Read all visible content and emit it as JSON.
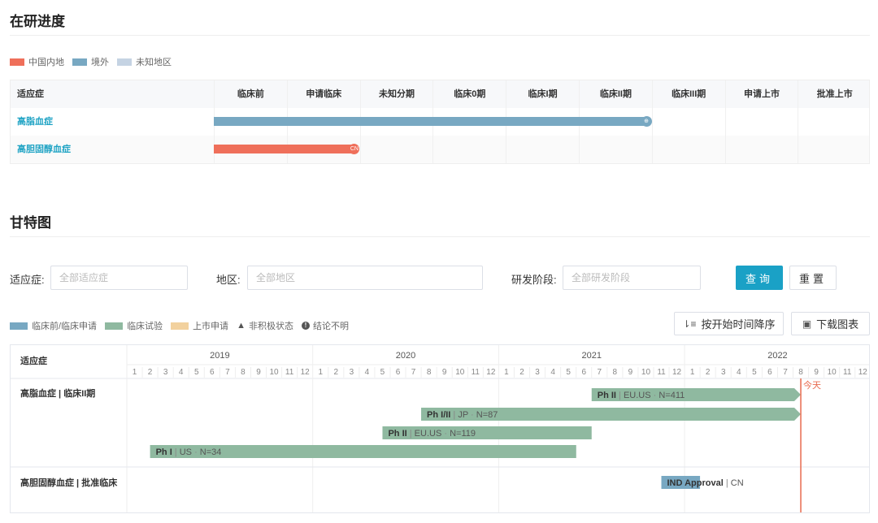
{
  "progress": {
    "title": "在研进度",
    "legend": [
      {
        "label": "中国内地",
        "color": "#ef6f5a"
      },
      {
        "label": "境外",
        "color": "#78a8c2"
      },
      {
        "label": "未知地区",
        "color": "#c5d3e3"
      }
    ],
    "indication_header": "适应症",
    "stages": [
      "临床前",
      "申请临床",
      "未知分期",
      "临床0期",
      "临床I期",
      "临床II期",
      "临床III期",
      "申请上市",
      "批准上市"
    ],
    "rows": [
      {
        "indication": "高脂血症",
        "stage_reached": 6,
        "color": "#78a8c2",
        "marker": "globe-icon",
        "marker_text": ""
      },
      {
        "indication": "高胆固醇血症",
        "stage_reached": 2,
        "color": "#ef6f5a",
        "marker": "cn-badge",
        "marker_text": "CN"
      }
    ]
  },
  "gantt": {
    "title": "甘特图",
    "filters": {
      "indication": {
        "label": "适应症:",
        "placeholder": "全部适应症"
      },
      "region": {
        "label": "地区:",
        "placeholder": "全部地区"
      },
      "phase": {
        "label": "研发阶段:",
        "placeholder": "全部研发阶段"
      }
    },
    "query_label": "查询",
    "reset_label": "重置",
    "legend": [
      {
        "label": "临床前/临床申请",
        "color": "#78a8c2",
        "shape": "swatch"
      },
      {
        "label": "临床试验",
        "color": "#8fb9a0",
        "shape": "swatch"
      },
      {
        "label": "上市申请",
        "color": "#f2d19e",
        "shape": "swatch"
      },
      {
        "label": "非积极状态",
        "color": "#555555",
        "shape": "triangle"
      },
      {
        "label": "结论不明",
        "color": "#555555",
        "shape": "info"
      }
    ],
    "sort_label": "按开始时间降序",
    "download_label": "下载图表",
    "indication_header": "适应症",
    "years": [
      2019,
      2020,
      2021,
      2022
    ],
    "months": [
      1,
      2,
      3,
      4,
      5,
      6,
      7,
      8,
      9,
      10,
      11,
      12
    ],
    "today_label": "今天",
    "today": 2022.625,
    "groups": [
      {
        "indication": "高脂血症 | 临床II期",
        "bars": [
          {
            "phase": "Ph II",
            "region": "EU.US",
            "n": "N=411",
            "start": 2021.5,
            "end": 2022.625,
            "arrow": true
          },
          {
            "phase": "Ph I/II",
            "region": "JP",
            "n": "N=87",
            "start": 2020.583,
            "end": 2022.625,
            "arrow": true
          },
          {
            "phase": "Ph II",
            "region": "EU.US",
            "n": "N=119",
            "start": 2020.375,
            "end": 2021.5,
            "arrow": false
          },
          {
            "phase": "Ph I",
            "region": "US",
            "n": "N=34",
            "start": 2019.125,
            "end": 2021.417,
            "arrow": false
          }
        ]
      },
      {
        "indication": "高胆固醇血症 | 批准临床",
        "bars": [
          {
            "phase": "IND Approval",
            "region": "CN",
            "n": "",
            "start": 2021.875,
            "end": 2022.083,
            "arrow": false,
            "type": "pre"
          }
        ]
      }
    ]
  }
}
